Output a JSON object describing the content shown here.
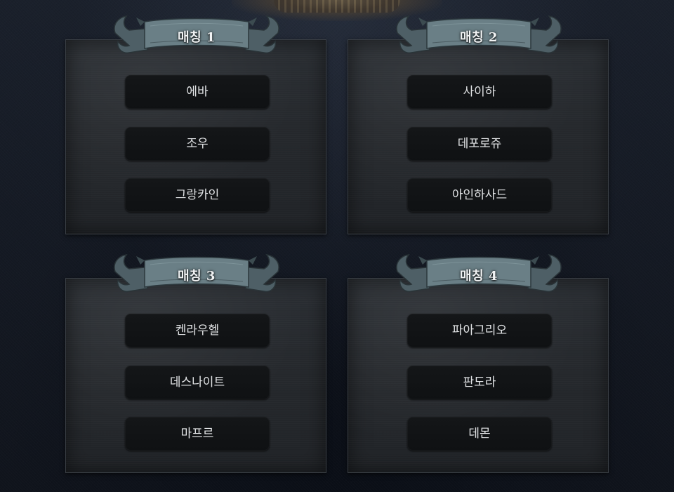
{
  "colors": {
    "background": "#151a24",
    "panel": "#26292d",
    "button": "#121416",
    "banner": "#5c7077",
    "text": "#e2e4e6"
  },
  "panels": [
    {
      "title": "매칭 1",
      "icon": "ribbon-banner-icon",
      "buttons": [
        "에바",
        "조우",
        "그랑카인"
      ]
    },
    {
      "title": "매칭 2",
      "icon": "ribbon-banner-icon",
      "buttons": [
        "사이하",
        "데포로쥬",
        "아인하사드"
      ]
    },
    {
      "title": "매칭 3",
      "icon": "ribbon-banner-icon",
      "buttons": [
        "켄라우헬",
        "데스나이트",
        "마프르"
      ]
    },
    {
      "title": "매칭 4",
      "icon": "ribbon-banner-icon",
      "buttons": [
        "파아그리오",
        "판도라",
        "데몬"
      ]
    }
  ]
}
